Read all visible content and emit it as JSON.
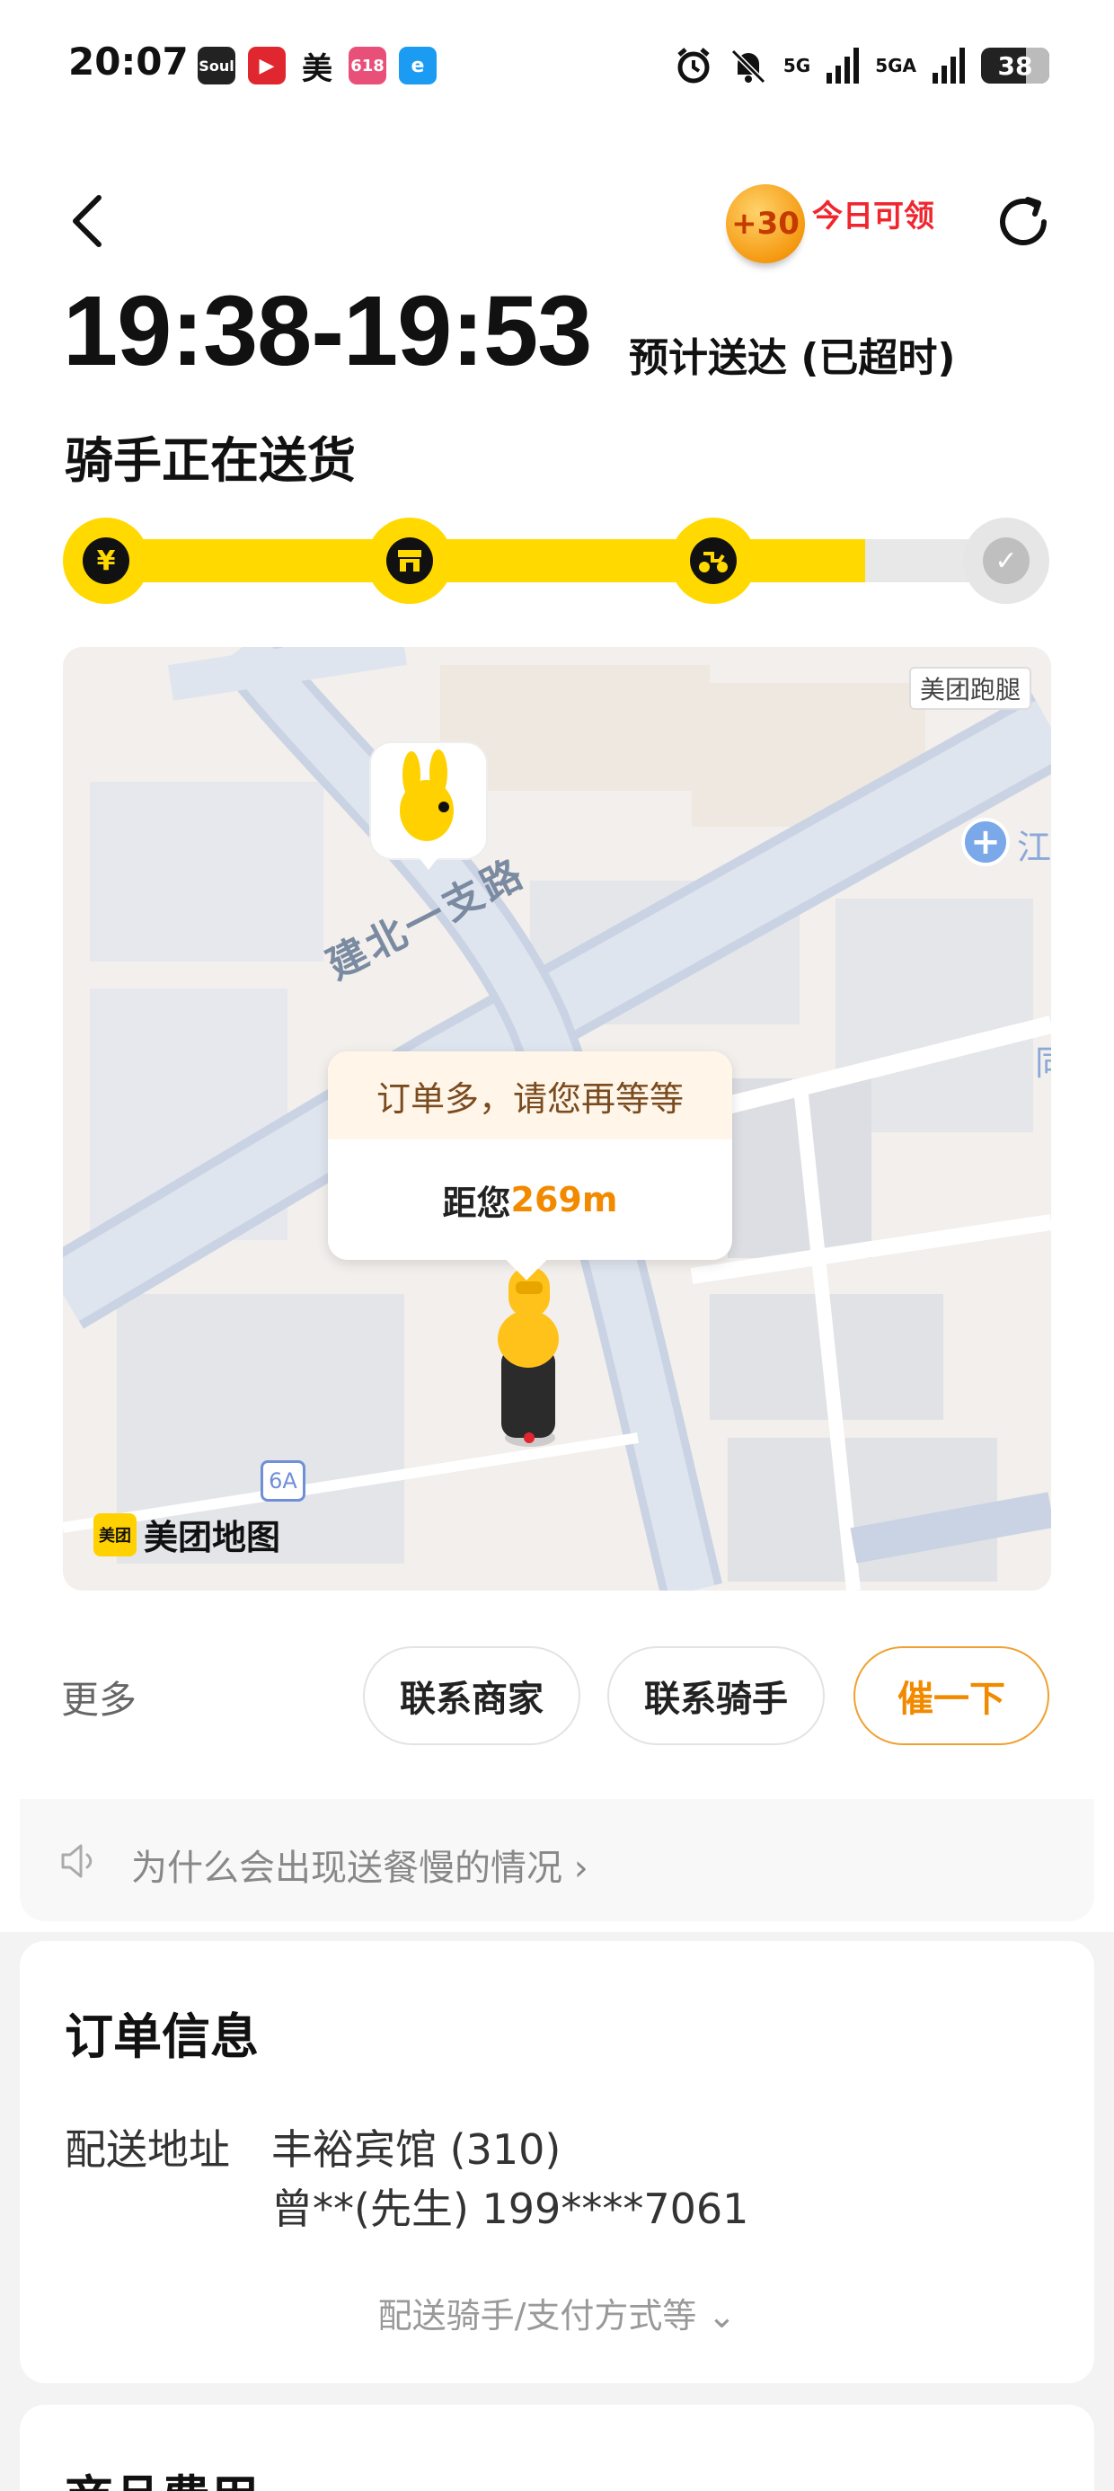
{
  "status_bar": {
    "time": "20:07",
    "apps": [
      "Soul",
      "video",
      "美",
      "618",
      "e"
    ],
    "network": "5G",
    "network2": "5GA",
    "battery": "38"
  },
  "header": {
    "bonus_coin": "+30",
    "bonus_label": "今日可领"
  },
  "eta": {
    "time_range": "19:38-19:53",
    "label": "预计送达 (已超时)"
  },
  "rider_status": "骑手正在送货",
  "progress": {
    "steps": [
      "paid",
      "store",
      "delivering",
      "delivered"
    ],
    "fill_fraction": 0.83
  },
  "map": {
    "badge": "美团跑腿",
    "road_label": "建北一支路",
    "bubble_message": "订单多，请您再等等",
    "distance_prefix": "距您",
    "distance_value": "269m",
    "logo_mark": "美团",
    "logo_text": "美团地图",
    "shield": "6A",
    "edge_label_1": "江",
    "edge_label_2": "同"
  },
  "actions": {
    "more": "更多",
    "contact_merchant": "联系商家",
    "contact_rider": "联系骑手",
    "urge": "催一下"
  },
  "tip": "为什么会出现送餐慢的情况 ›",
  "order_info": {
    "title": "订单信息",
    "address_label": "配送地址",
    "address_line1": "丰裕宾馆 (310)",
    "address_line2": "曾**(先生) 199****7061",
    "expand_label": "配送骑手/支付方式等 ⌄"
  },
  "next_section": {
    "title": "商品费用"
  },
  "colors": {
    "accent_yellow": "#ffd900",
    "accent_orange": "#f28a00",
    "alert_red": "#f0262f"
  }
}
